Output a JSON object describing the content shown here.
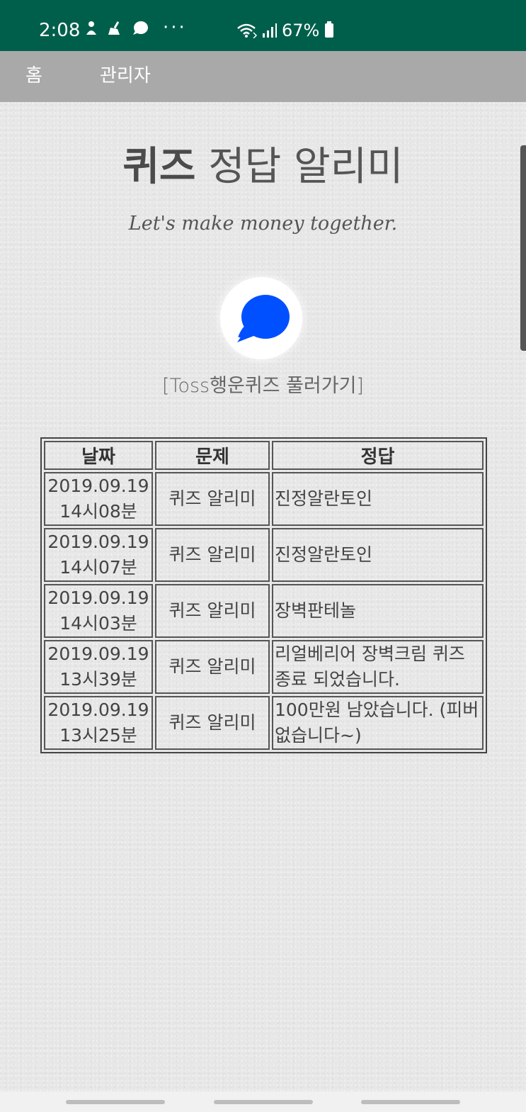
{
  "status_bar": {
    "time": "2:08",
    "more": "···",
    "battery": "67%",
    "icons": [
      "person-icon",
      "broom-icon",
      "chat-icon",
      "wifi-icon",
      "signal-icon",
      "battery-icon"
    ]
  },
  "nav": {
    "home": "홈",
    "admin": "관리자"
  },
  "hero": {
    "title_bold": "퀴즈",
    "title_rest": " 정답 알리미",
    "subtitle": "Let's make money together.",
    "link": "[Toss행운퀴즈 풀러가기]"
  },
  "colors": {
    "status_bg": "#005f4b",
    "nav_bg": "#a9a9a9",
    "toss_blue": "#0050ff"
  },
  "table": {
    "headers": [
      "날짜",
      "문제",
      "정답"
    ],
    "rows": [
      {
        "date": "2019.09.19",
        "time": "14시08분",
        "quiz": "퀴즈 알리미",
        "answer": "진정알란토인"
      },
      {
        "date": "2019.09.19",
        "time": "14시07분",
        "quiz": "퀴즈 알리미",
        "answer": "진정알란토인"
      },
      {
        "date": "2019.09.19",
        "time": "14시03분",
        "quiz": "퀴즈 알리미",
        "answer": "장벽판테놀"
      },
      {
        "date": "2019.09.19",
        "time": "13시39분",
        "quiz": "퀴즈 알리미",
        "answer": "리얼베리어 장벽크림 퀴즈 종료 되었습니다."
      },
      {
        "date": "2019.09.19",
        "time": "13시25분",
        "quiz": "퀴즈 알리미",
        "answer": "100만원 남았습니다. (피버 없습니다~)"
      }
    ]
  }
}
